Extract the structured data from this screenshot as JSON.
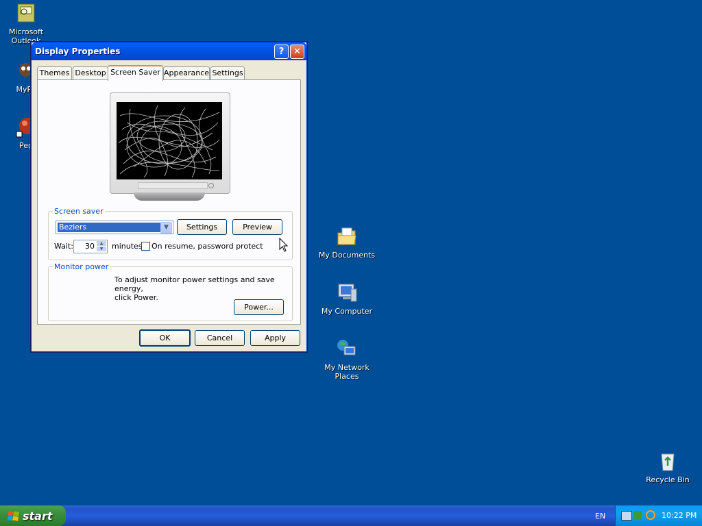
{
  "desktop": {
    "icons": [
      {
        "label": "Microsoft Outlook"
      },
      {
        "label": "MyPa"
      },
      {
        "label": "Peg"
      },
      {
        "label": "My Documents"
      },
      {
        "label": "My Computer"
      },
      {
        "label": "My Network Places"
      },
      {
        "label": "Recycle Bin"
      }
    ]
  },
  "window": {
    "title": "Display Properties",
    "tabs": [
      "Themes",
      "Desktop",
      "Screen Saver",
      "Appearance",
      "Settings"
    ],
    "active_tab": "Screen Saver",
    "screen_saver": {
      "group_label": "Screen saver",
      "selected": "Beziers",
      "settings_label": "Settings",
      "preview_label": "Preview",
      "wait_label": "Wait:",
      "wait_value": "30",
      "minutes_label": "minutes",
      "password_label": "On resume, password protect",
      "password_checked": false
    },
    "monitor_power": {
      "group_label": "Monitor power",
      "text_line1": "To adjust monitor power settings and save energy,",
      "text_line2": "click Power.",
      "power_label": "Power..."
    },
    "buttons": {
      "ok": "OK",
      "cancel": "Cancel",
      "apply": "Apply"
    }
  },
  "taskbar": {
    "start_label": "start",
    "language": "EN",
    "time": "10:22 PM"
  },
  "colors": {
    "desktop": "#004e98",
    "titlebar": "#0054e3",
    "selection": "#316ac5"
  }
}
